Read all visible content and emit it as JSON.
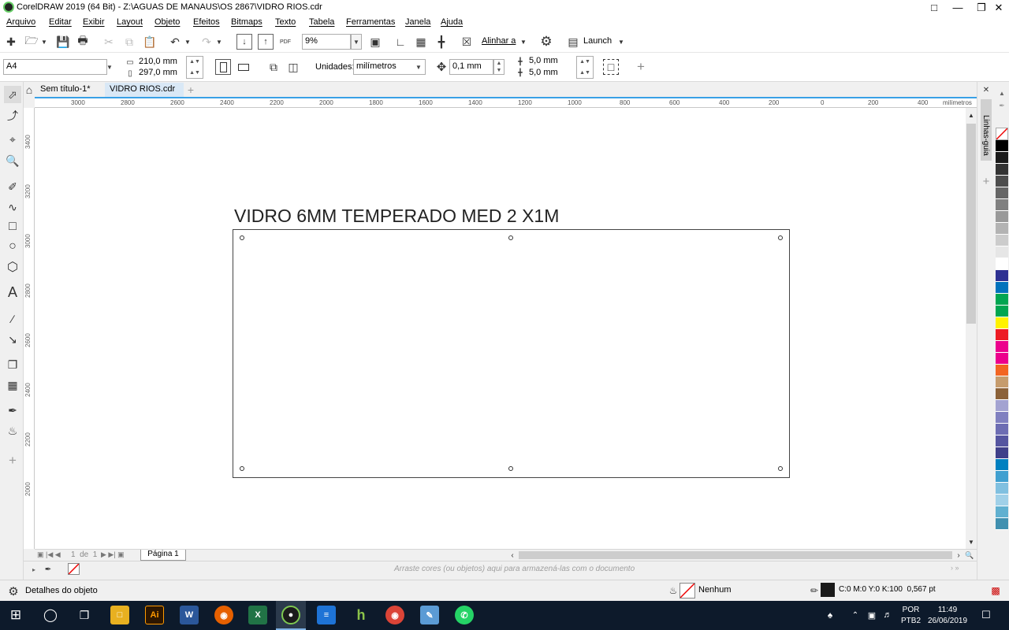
{
  "window": {
    "title": "CorelDRAW 2019 (64 Bit) - Z:\\AGUAS DE MANAUS\\OS 2867\\VIDRO RIOS.cdr"
  },
  "menu": [
    "Arquivo",
    "Editar",
    "Exibir",
    "Layout",
    "Objeto",
    "Efeitos",
    "Bitmaps",
    "Texto",
    "Tabela",
    "Ferramentas",
    "Janela",
    "Ajuda"
  ],
  "toolbar": {
    "zoom_value": "9%",
    "align_label": "Alinhar a",
    "launch_label": "Launch"
  },
  "properties": {
    "page_size": "A4",
    "width": "210,0 mm",
    "height": "297,0 mm",
    "units_label": "Unidades:",
    "units_value": "milímetros",
    "nudge": "0,1 mm",
    "dup_x": "5,0 mm",
    "dup_y": "5,0 mm"
  },
  "tabs": [
    {
      "label": "Sem título-1*",
      "active": false
    },
    {
      "label": "VIDRO RIOS.cdr",
      "active": true
    }
  ],
  "ruler": {
    "h_ticks": [
      "3000",
      "2800",
      "2600",
      "2400",
      "2200",
      "2000",
      "1800",
      "1600",
      "1400",
      "1200",
      "1000",
      "800",
      "600",
      "400",
      "200",
      "0",
      "200",
      "400"
    ],
    "unit": "milímetros",
    "v_ticks": [
      "3400",
      "3200",
      "3000",
      "2800",
      "2600",
      "2400",
      "2200",
      "2000"
    ]
  },
  "document": {
    "heading": "VIDRO 6MM TEMPERADO MED 2 X1M"
  },
  "dock": {
    "guides_label": "Linhas-guia"
  },
  "palette_colors": [
    "#000000",
    "#1a1a1a",
    "#333333",
    "#4d4d4d",
    "#666666",
    "#808080",
    "#999999",
    "#b3b3b3",
    "#cccccc",
    "#e6e6e6",
    "#ffffff",
    "#2e3192",
    "#0072bc",
    "#00a651",
    "#00a651",
    "#fff200",
    "#ed1c24",
    "#ec008c",
    "#ec008c",
    "#f26522",
    "#c69c6d",
    "#8c6239",
    "#a3a3d1",
    "#8080c0",
    "#6d6db3",
    "#5555a0",
    "#40408a",
    "#0080c0",
    "#40a0d0",
    "#80c0e0",
    "#a0d0e8",
    "#60b0d0",
    "#4090b0"
  ],
  "pagebar": {
    "page_of": "1  de  1",
    "page_tab": "Página 1"
  },
  "colorwell": {
    "hint": "Arraste cores (ou objetos) aqui para armazená-las com o documento"
  },
  "status": {
    "object_details": "Detalhes do objeto",
    "fill": "Nenhum",
    "outline": "C:0 M:0 Y:0 K:100  0,567 pt"
  },
  "taskbar": {
    "lang1": "POR",
    "lang2": "PTB2",
    "time": "11:49",
    "date": "26/06/2019"
  }
}
